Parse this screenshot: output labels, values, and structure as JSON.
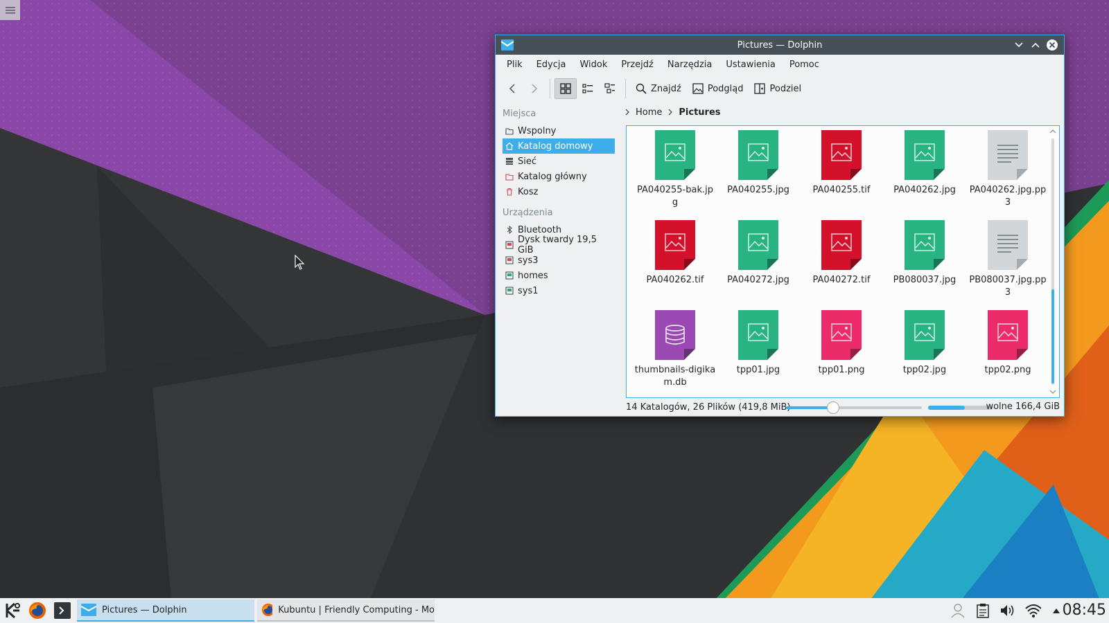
{
  "window": {
    "title": "Pictures — Dolphin"
  },
  "menu": [
    "Plik",
    "Edycja",
    "Widok",
    "Przejdź",
    "Narzędzia",
    "Ustawienia",
    "Pomoc"
  ],
  "toolbar": {
    "find_label": "Znajdź",
    "preview_label": "Podgląd",
    "split_label": "Podziel",
    "active_view": "icons"
  },
  "places": {
    "group_places": "Miejsca",
    "group_devices": "Urządzenia",
    "items": [
      {
        "label": "Wspolny",
        "icon": "folder-icon"
      },
      {
        "label": "Katalog domowy",
        "icon": "home-icon",
        "selected": true
      },
      {
        "label": "Sieć",
        "icon": "network-icon"
      },
      {
        "label": "Katalog główny",
        "icon": "root-folder-icon"
      },
      {
        "label": "Kosz",
        "icon": "trash-icon"
      }
    ],
    "devices": [
      {
        "label": "Bluetooth",
        "icon": "bluetooth-icon"
      },
      {
        "label": "Dysk twardy 19,5 GiB",
        "icon": "harddisk-icon"
      },
      {
        "label": "sys3",
        "icon": "harddisk-icon"
      },
      {
        "label": "homes",
        "icon": "network-drive-icon"
      },
      {
        "label": "sys1",
        "icon": "network-drive-icon"
      }
    ]
  },
  "breadcrumb": {
    "home": "Home",
    "current": "Pictures"
  },
  "files": [
    {
      "name": "PA040255-bak.jpg",
      "type": "jpg"
    },
    {
      "name": "PA040255.jpg",
      "type": "jpg"
    },
    {
      "name": "PA040255.tif",
      "type": "tif"
    },
    {
      "name": "PA040262.jpg",
      "type": "jpg"
    },
    {
      "name": "PA040262.jpg.pp3",
      "type": "pp3"
    },
    {
      "name": "PA040262.tif",
      "type": "tif"
    },
    {
      "name": "PA040272.jpg",
      "type": "jpg"
    },
    {
      "name": "PA040272.tif",
      "type": "tif"
    },
    {
      "name": "PB080037.jpg",
      "type": "jpg"
    },
    {
      "name": "PB080037.jpg.pp3",
      "type": "pp3"
    },
    {
      "name": "thumbnails-digikam.db",
      "type": "db"
    },
    {
      "name": "tpp01.jpg",
      "type": "jpg"
    },
    {
      "name": "tpp01.png",
      "type": "png"
    },
    {
      "name": "tpp02.jpg",
      "type": "jpg"
    },
    {
      "name": "tpp02.png",
      "type": "png"
    }
  ],
  "file_colors": {
    "jpg": "#27b482",
    "tif": "#d4112a",
    "pp3": "#d3d6d9",
    "db": "#9b4ab3",
    "png": "#ec2c6a"
  },
  "status": {
    "summary": "14 Katalogów, 26 Plików (419,8 MiB)",
    "zoom_fraction": 0.33,
    "space_used_fraction": 0.56,
    "free_label": "wolne 166,4 GiB"
  },
  "taskbar": {
    "tasks": [
      {
        "label": "Pictures — Dolphin",
        "active": true
      },
      {
        "label": "Kubuntu | Friendly Computing - Mo",
        "active": false
      }
    ],
    "clock": "08:45"
  },
  "colors": {
    "accent": "#3daee9",
    "titlebar": "#475057"
  }
}
